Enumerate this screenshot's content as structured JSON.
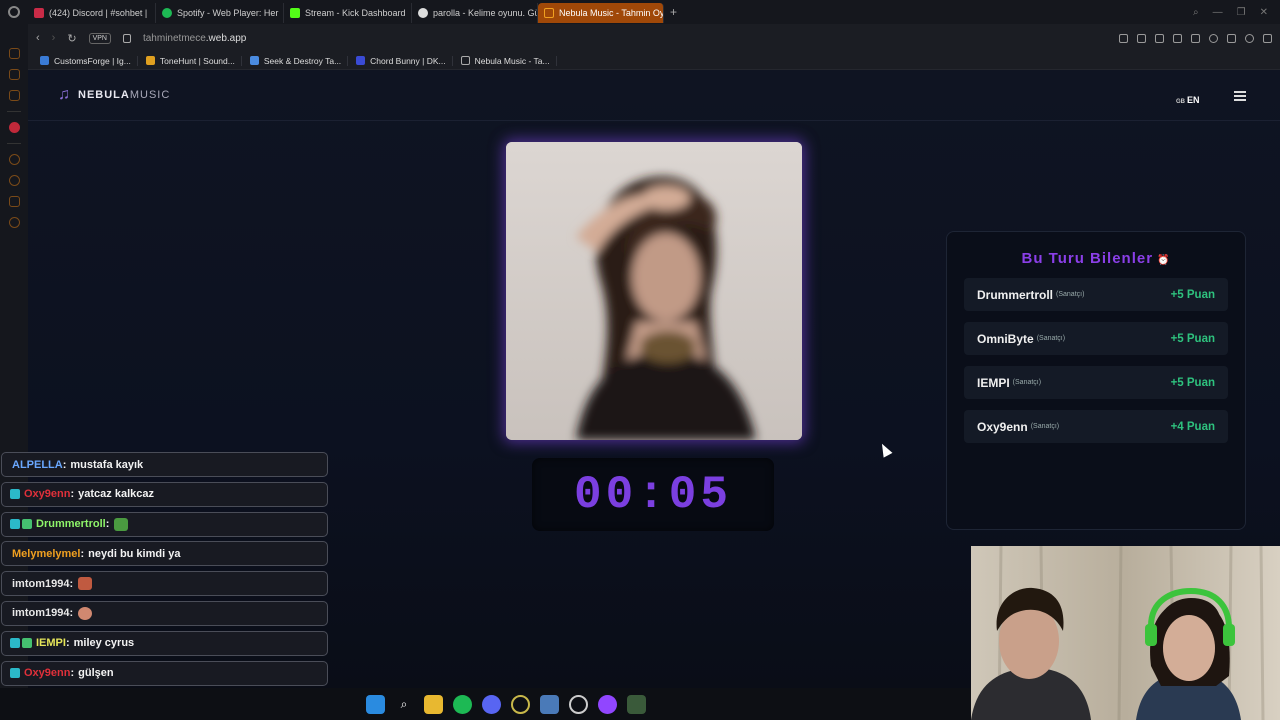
{
  "browser": {
    "tabs": [
      {
        "label": "(424) Discord | #sohbet |",
        "color": "#c92b47"
      },
      {
        "label": "Spotify - Web Player: Her",
        "color": "#1db954"
      },
      {
        "label": "Stream - Kick Dashboard",
        "color": "#53fc18"
      },
      {
        "label": "parolla - Kelime oyunu. Gü",
        "color": "#dddddd"
      },
      {
        "label": "Nebula Music - Tahmin Oy",
        "color": "#f0a020",
        "active": true
      }
    ],
    "new_tab": "+",
    "url_prefix": "tahminetmece",
    "url_domain": ".web.app",
    "vpn": "VPN",
    "bookmarks": [
      {
        "label": "CustomsForge | Ig...",
        "color": "#3a7bd5"
      },
      {
        "label": "ToneHunt | Sound...",
        "color": "#e0a020"
      },
      {
        "label": "Seek & Destroy Ta...",
        "color": "#4a8be0"
      },
      {
        "label": "Chord Bunny | DK...",
        "color": "#3a4bd5"
      },
      {
        "label": "Nebula Music - Ta...",
        "color": "#aaaaaa"
      }
    ]
  },
  "app": {
    "logo_bold": "NEBULA",
    "logo_light": "MUSIC",
    "lang_flag": "GB",
    "lang": "EN",
    "timer": "00:05",
    "panel_title": "Bu Turu Bilenler",
    "winners": [
      {
        "name": "Drummertroll",
        "role": "(Sanatçı)",
        "points": "+5 Puan"
      },
      {
        "name": "OmniByte",
        "role": "(Sanatçı)",
        "points": "+5 Puan"
      },
      {
        "name": "IEMPI",
        "role": "(Sanatçı)",
        "points": "+5 Puan"
      },
      {
        "name": "Oxy9enn",
        "role": "(Sanatçı)",
        "points": "+4 Puan"
      }
    ]
  },
  "chat": [
    {
      "user": "ALPELLA",
      "color": "#6aa8ff",
      "text": "mustafa kayık",
      "badges": 0
    },
    {
      "user": "Oxy9enn",
      "color": "#e0303a",
      "text": "yatcaz kalkcaz",
      "badges": 1
    },
    {
      "user": "Drummertroll",
      "color": "#8ef56a",
      "text": "",
      "badges": 2,
      "emote": "#4a9a40"
    },
    {
      "user": "Melymelymel",
      "color": "#f0a020",
      "text": "neydi bu kimdi ya",
      "badges": 0
    },
    {
      "user": "imtom1994",
      "color": "#e8e8e8",
      "text": "",
      "badges": 0,
      "emote": "#c05a40"
    },
    {
      "user": "imtom1994",
      "color": "#e8e8e8",
      "text": "",
      "badges": 0,
      "emote": "#d08870"
    },
    {
      "user": "IEMPI",
      "color": "#e6e65a",
      "text": "miley cyrus",
      "badges": 2
    },
    {
      "user": "Oxy9enn",
      "color": "#e0303a",
      "text": "gülşen",
      "badges": 1
    }
  ],
  "chat_separator": " :",
  "taskbar": [
    "windows",
    "search",
    "files",
    "spotify",
    "discord",
    "opera",
    "app",
    "obs",
    "twitch",
    "app2"
  ]
}
